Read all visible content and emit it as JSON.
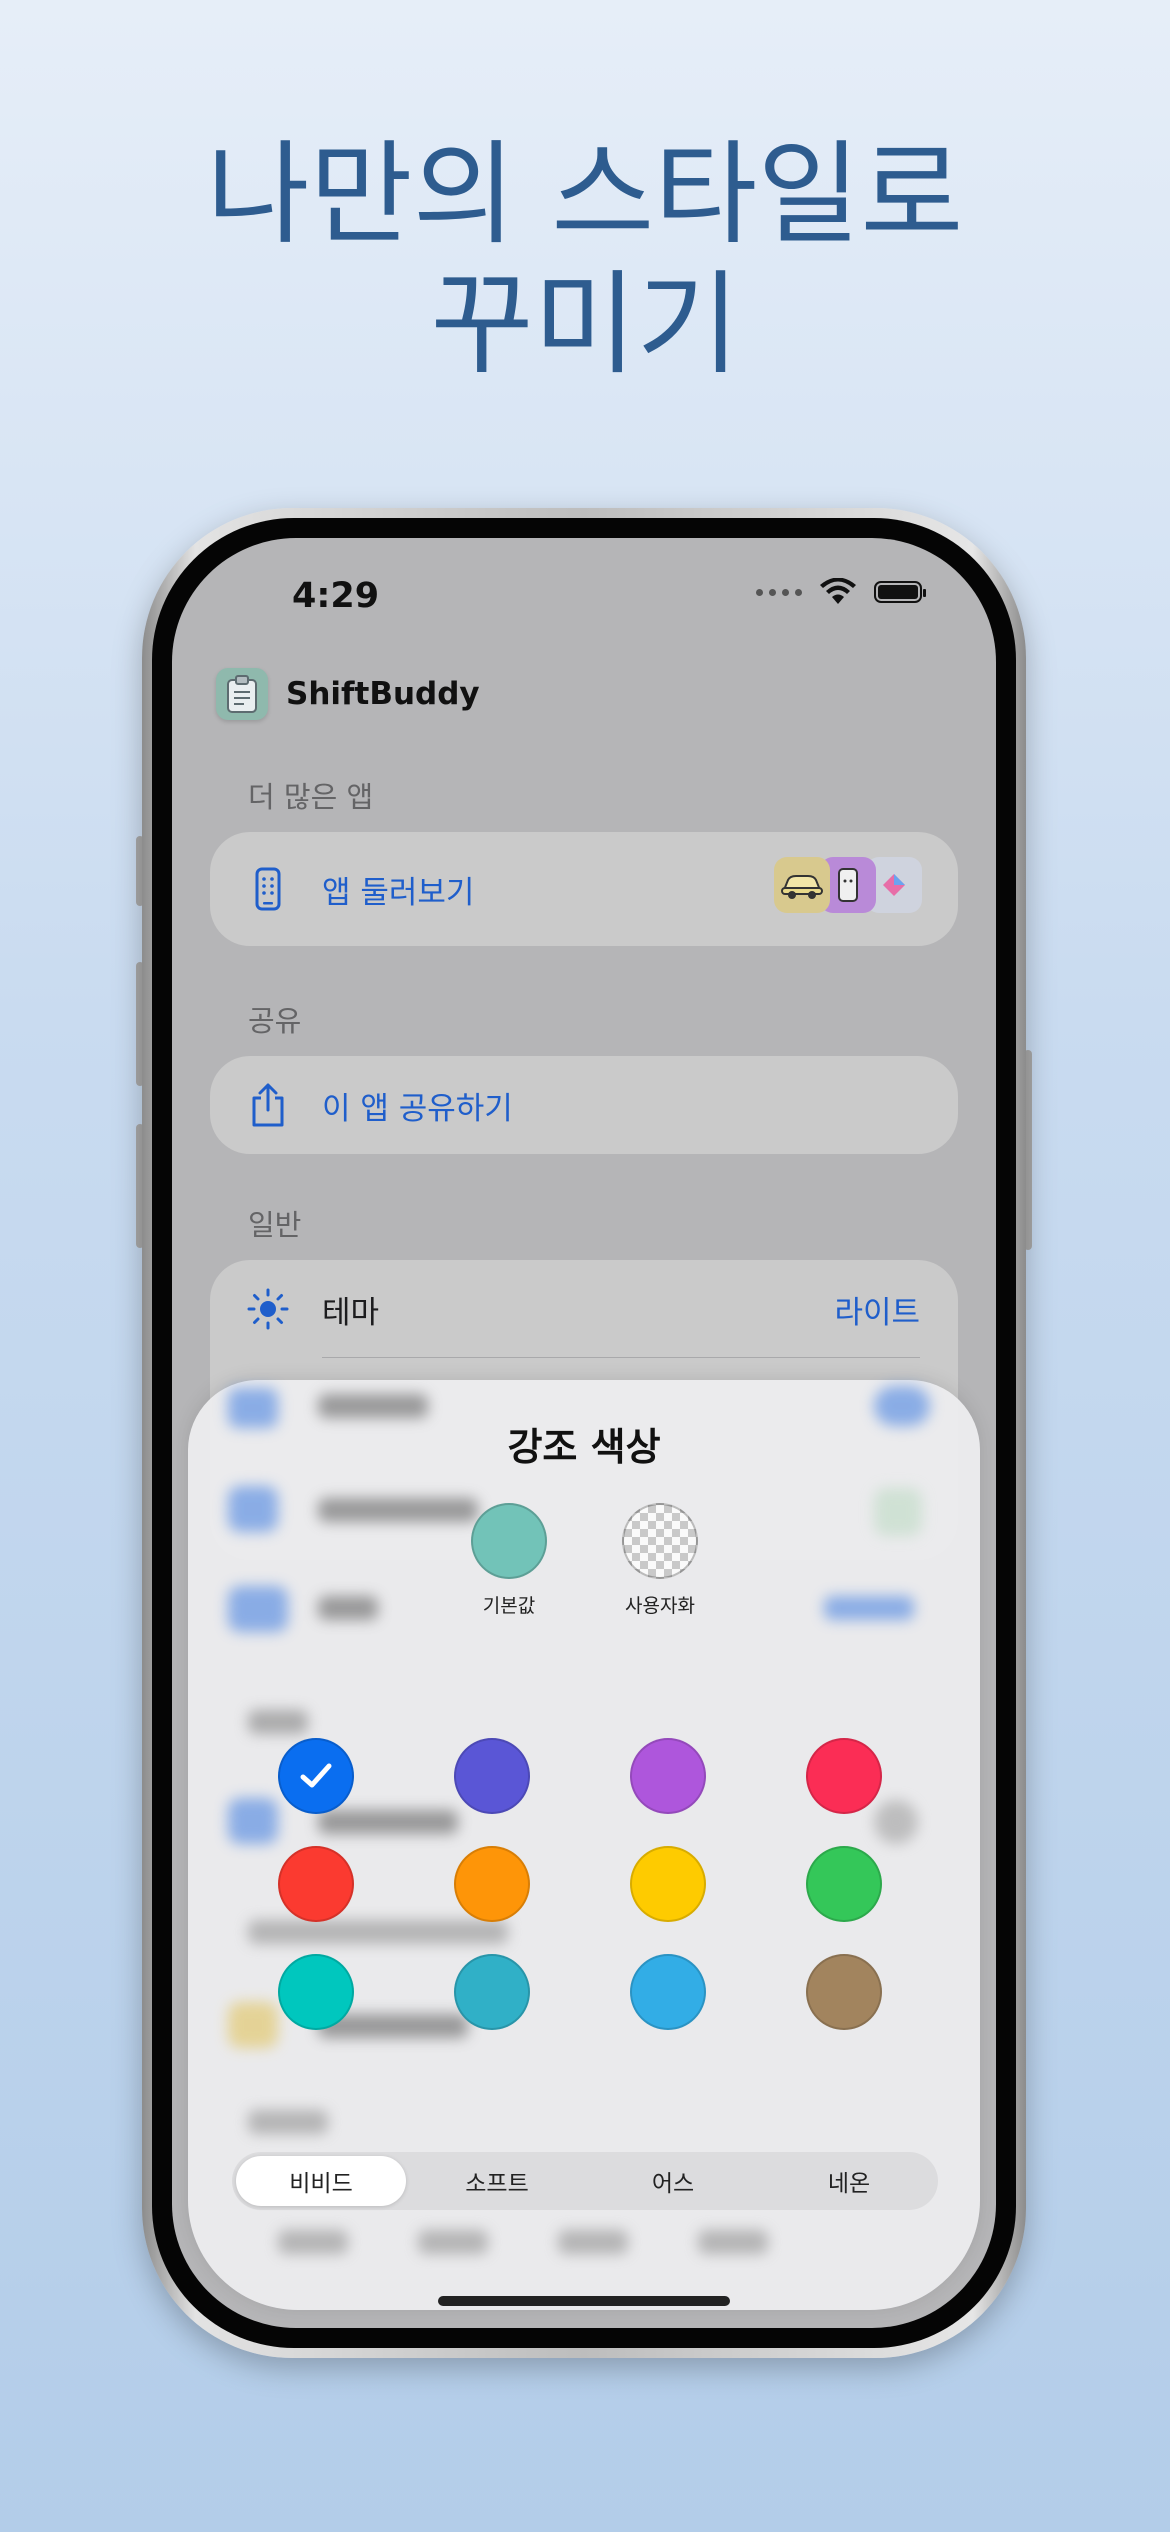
{
  "headline": {
    "line1": "나만의 스타일로",
    "line2": "꾸미기"
  },
  "status_bar": {
    "time": "4:29"
  },
  "app": {
    "name": "ShiftBuddy"
  },
  "sections": {
    "more_apps": {
      "label": "더 많은 앱",
      "row_label": "앱 둘러보기"
    },
    "share": {
      "label": "공유",
      "row_label": "이 앱 공유하기"
    },
    "general": {
      "label": "일반",
      "theme_label": "테마",
      "theme_value": "라이트"
    }
  },
  "accent_sheet": {
    "title": "강조 색상",
    "presets": [
      {
        "label": "기본값",
        "color": "#72c3b8"
      },
      {
        "label": "사용자화",
        "color": "checkerboard"
      }
    ],
    "selected_index": 0,
    "swatches": [
      "#0a6ef0",
      "#5a56d6",
      "#ae56dc",
      "#fb2d55",
      "#fb3a30",
      "#fe9508",
      "#fecb00",
      "#34c759",
      "#00c7be",
      "#30b0c7",
      "#32ade6",
      "#a2845e"
    ],
    "tabs": [
      "비비드",
      "소프트",
      "어스",
      "네온"
    ],
    "active_tab": "비비드"
  }
}
